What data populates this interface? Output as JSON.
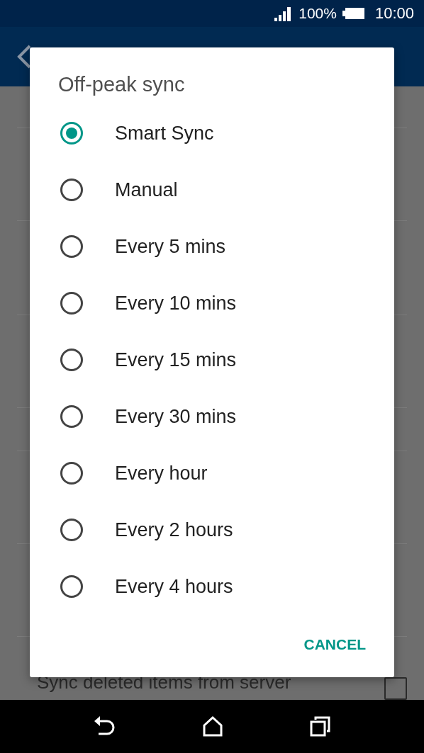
{
  "status_bar": {
    "battery": "100%",
    "time": "10:00"
  },
  "background": {
    "setting_title": "Sync deleted items from server",
    "checkbox": {
      "checked": false
    }
  },
  "dialog": {
    "title": "Off-peak sync",
    "options": [
      {
        "label": "Smart Sync",
        "selected": true
      },
      {
        "label": "Manual",
        "selected": false
      },
      {
        "label": "Every 5 mins",
        "selected": false
      },
      {
        "label": "Every 10 mins",
        "selected": false
      },
      {
        "label": "Every 15 mins",
        "selected": false
      },
      {
        "label": "Every 30 mins",
        "selected": false
      },
      {
        "label": "Every hour",
        "selected": false
      },
      {
        "label": "Every 2 hours",
        "selected": false
      },
      {
        "label": "Every 4 hours",
        "selected": false
      }
    ],
    "buttons": [
      "CANCEL"
    ]
  }
}
